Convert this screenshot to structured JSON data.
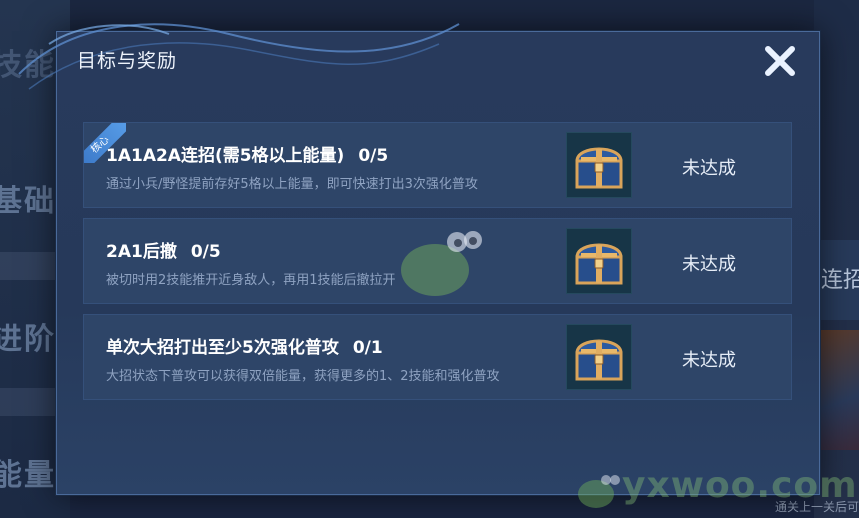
{
  "background": {
    "left_labels": [
      "技能",
      "基础",
      "进阶",
      "能量"
    ],
    "right_label": "连招",
    "bottom_note": "通关上一关后可"
  },
  "modal": {
    "title": "目标与奖励",
    "close_icon": "close-x-icon",
    "tasks": [
      {
        "badge": "核心",
        "title": "1A1A2A连招(需5格以上能量)",
        "progress": "0/5",
        "description": "通过小兵/野怪提前存好5格以上能量，即可快速打出3次强化普攻",
        "reward_icon": "treasure-chest-icon",
        "status": "未达成"
      },
      {
        "badge": "",
        "title": "2A1后撤",
        "progress": "0/5",
        "description": "被切时用2技能推开近身敌人，再用1技能后撤拉开",
        "reward_icon": "treasure-chest-icon",
        "status": "未达成"
      },
      {
        "badge": "",
        "title": "单次大招打出至少5次强化普攻",
        "progress": "0/1",
        "description": "大招状态下普攻可以获得双倍能量，获得更多的1、2技能和强化普攻",
        "reward_icon": "treasure-chest-icon",
        "status": "未达成"
      }
    ]
  },
  "watermark": "yxwoo.com",
  "colors": {
    "modal_bg": "#283a5c",
    "task_bg": "#2e4568",
    "badge": "#4a8ad8",
    "text_primary": "#ffffff",
    "text_secondary": "#8fa3c2"
  }
}
